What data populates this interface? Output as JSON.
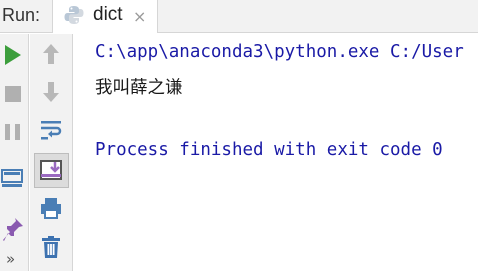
{
  "run_panel": {
    "label": "Run:",
    "tab": {
      "label": "dict",
      "close_glyph": "×",
      "icon": "python-icon"
    }
  },
  "toolbar_left": [
    {
      "name": "rerun-icon",
      "color": "#3c9e3c"
    },
    {
      "name": "stop-icon",
      "color": "#b0b0b0"
    },
    {
      "name": "pause-icon",
      "color": "#b0b0b0"
    },
    {
      "name": "layout-icon",
      "color": "#4a7eb5"
    },
    {
      "name": "pin-icon",
      "color": "#8a5ab0"
    }
  ],
  "toolbar_right": [
    {
      "name": "up-arrow-icon",
      "color": "#b8b8b8"
    },
    {
      "name": "down-arrow-icon",
      "color": "#b8b8b8"
    },
    {
      "name": "soft-wrap-icon",
      "color": "#4a7eb5"
    },
    {
      "name": "scroll-to-end-icon",
      "color": "#9a6ac0"
    },
    {
      "name": "print-icon",
      "color": "#4a7eb5"
    },
    {
      "name": "trash-icon",
      "color": "#3d72b0"
    }
  ],
  "console": {
    "command_line": "C:\\app\\anaconda3\\python.exe C:/User",
    "output_line": "我叫薛之谦",
    "exit_line": "Process finished with exit code 0"
  },
  "more_glyph": "»"
}
